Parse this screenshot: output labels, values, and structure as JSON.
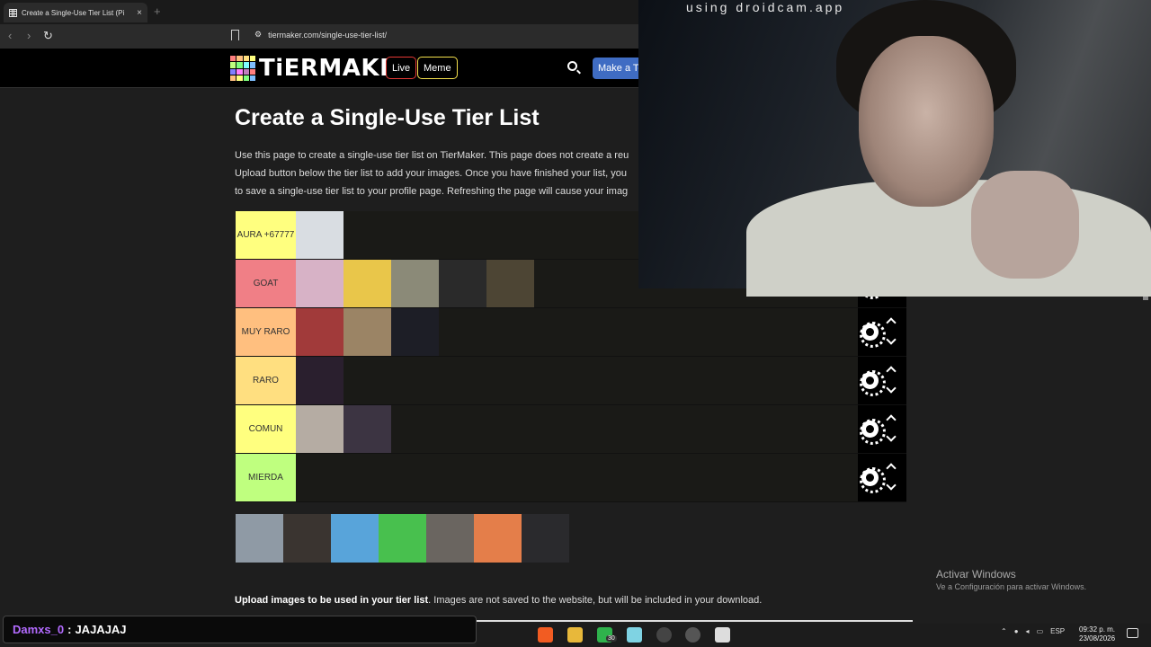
{
  "browser": {
    "tab_title": "Create a Single-Use Tier List (Pi",
    "tab_close": "×",
    "new_tab": "+",
    "url": "tiermaker.com/single-use-tier-list/"
  },
  "site": {
    "logo_text": "TiERMAKER",
    "live_label": "Live",
    "meme_label": "Meme",
    "make_label": "Make a Te"
  },
  "page": {
    "title": "Create a Single-Use Tier List",
    "desc_line1": "Use this page to create a single-use tier list on TierMaker. This page does not create a reu",
    "desc_line2": "Upload button below the tier list to add your images. Once you have finished your list, you",
    "desc_line3": "to save a single-use tier list to your profile page. Refreshing the page will cause your imag"
  },
  "tiers": [
    {
      "label": "AURA +67777",
      "color": "#ffff7f",
      "items": [
        "#d9dde2"
      ]
    },
    {
      "label": "GOAT",
      "color": "#f07f86",
      "items": [
        "#d7b2c6",
        "#e9c64a",
        "#8b8a78",
        "#2a2a2a",
        "#4d4534"
      ]
    },
    {
      "label": "MUY RARO",
      "color": "#ffbf7f",
      "items": [
        "#a13a3a",
        "#9b8465",
        "#1d1e26"
      ]
    },
    {
      "label": "RARO",
      "color": "#ffdf80",
      "items": [
        "#2a1f2e"
      ]
    },
    {
      "label": "COMUN",
      "color": "#ffff7f",
      "items": [
        "#b5aca3",
        "#3c3442"
      ]
    },
    {
      "label": "MIERDA",
      "color": "#bfff7f",
      "items": []
    }
  ],
  "pool_items": [
    "#8f9aa5",
    "#3a3430",
    "#58a4da",
    "#48c04e",
    "#6a6560",
    "#e47e4a",
    "#2a2a2d"
  ],
  "upload": {
    "bold": "Upload images to be used in your tier list",
    "rest": ". Images are not saved to the website, but will be included in your download."
  },
  "webcam": {
    "overlay_text": "using droidcam.app"
  },
  "windows": {
    "activate_title": "Activar Windows",
    "activate_sub": "Ve a Configuración para activar Windows."
  },
  "chat": {
    "user": "Damxs_0",
    "separator": ":",
    "message": "JAJAJAJ"
  },
  "taskbar": {
    "lang": "ESP",
    "time": "09:32 p. m.",
    "date": "23/08/2026",
    "badge": "30"
  }
}
